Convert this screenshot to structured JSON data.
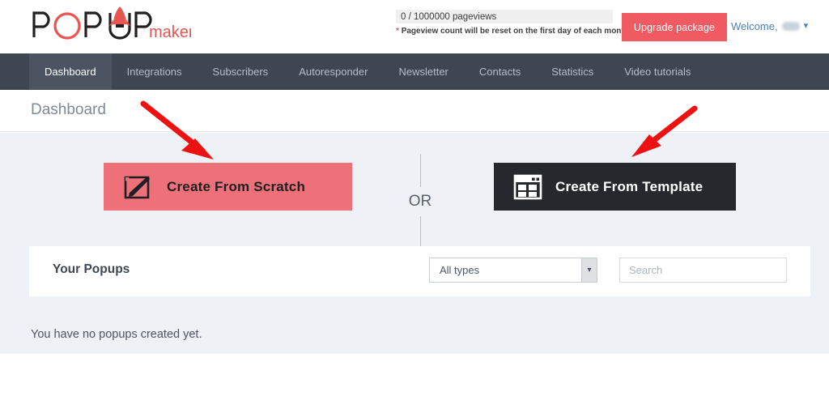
{
  "header": {
    "logo": {
      "text_dark": "POPUP",
      "text_accent": "maker",
      "rocket_icon": "rocket-icon",
      "accent_color": "#e8544f"
    },
    "pageviews": {
      "counter_text": "0 / 1000000 pageviews",
      "used": 0,
      "limit": 1000000,
      "note_star": "*",
      "note_text": "Pageview count will be reset on the first day of each month."
    },
    "upgrade_label": "Upgrade package",
    "upgrade_color": "#ef5a63",
    "welcome_label": "Welcome,",
    "welcome_user": "",
    "chevron_icon": "chevron-down-icon"
  },
  "nav": {
    "items": [
      {
        "label": "Dashboard",
        "active": true
      },
      {
        "label": "Integrations",
        "active": false
      },
      {
        "label": "Subscribers",
        "active": false
      },
      {
        "label": "Autoresponder",
        "active": false
      },
      {
        "label": "Newsletter",
        "active": false
      },
      {
        "label": "Contacts",
        "active": false
      },
      {
        "label": "Statistics",
        "active": false
      },
      {
        "label": "Video tutorials",
        "active": false
      }
    ]
  },
  "page": {
    "title": "Dashboard"
  },
  "main": {
    "create_scratch": {
      "label": "Create From Scratch",
      "icon": "pencil-square-icon",
      "bg_color": "#ee7079"
    },
    "create_template": {
      "label": "Create From Template",
      "icon": "template-grid-icon",
      "bg_color": "#26282d"
    },
    "divider_label": "OR",
    "popups_card": {
      "title": "Your Popups",
      "type_filter": {
        "selected": "All types",
        "options": [
          "All types"
        ],
        "arrow_icon": "chevron-down-icon"
      },
      "search": {
        "value": "",
        "placeholder": "Search"
      }
    },
    "empty_message": "You have no popups created yet."
  },
  "annotations": {
    "arrow_left": "red-arrow-pointing-to-create-from-scratch",
    "arrow_right": "red-arrow-pointing-to-create-from-template",
    "arrow_color": "#ee1111"
  }
}
